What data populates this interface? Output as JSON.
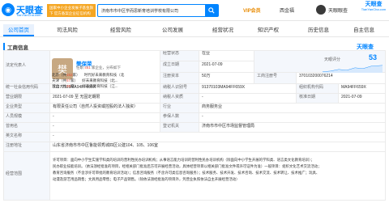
{
  "header": {
    "brand_name": "天眼查",
    "brand_sub": "TianYanCha.com",
    "promo_text": "国家中小企业发展子基金旗下 官方备案企业征信机构",
    "search_value": "济南市市中区学而思新育培训学校有限公司",
    "nav": {
      "vip": "VIP会员",
      "xixin": "西金福",
      "user": "天眼眼查"
    },
    "corner_brand": "天眼查",
    "corner_sub": "TianYanCha.com"
  },
  "tabs": [
    {
      "label": "公司首页",
      "count": ""
    },
    {
      "label": "司法风险",
      "count": ""
    },
    {
      "label": "经营风险",
      "count": ""
    },
    {
      "label": "公司发展",
      "count": ""
    },
    {
      "label": "经营状况",
      "count": ""
    },
    {
      "label": "知识产权",
      "count": ""
    },
    {
      "label": "历史信息",
      "count": ""
    },
    {
      "label": "自主信息",
      "count": ""
    }
  ],
  "section": {
    "title": "工商信息",
    "note": "",
    "brand_right": "天眼查"
  },
  "legal_person": {
    "label": "法定代表人",
    "avatar_char": "樊",
    "name": "樊保荣",
    "meta_prefix": "任职",
    "meta_count": "461",
    "meta_suffix": "家企业，分布如下",
    "rows": [
      {
        "region": "北京",
        "count": "152",
        "company": "时代好未来教育科技（北"
      },
      {
        "region": "天津",
        "count": "57",
        "company": "好未来教育科技（北..."
      },
      {
        "region": "河北",
        "count": "25",
        "company": "好未来教育科技（江..."
      }
    ],
    "tag": "老板"
  },
  "rows": {
    "status_label": "经营状态",
    "status_value": "在业",
    "established_label": "成立日期",
    "established_value": "2021-07-09",
    "reg_capital_label": "注册资本",
    "reg_capital_value": "50万",
    "paid_capital_label": "实缴资本",
    "paid_capital_value": "-",
    "rating_label": "天眼评分",
    "rating_value": "53",
    "reg_no_label": "工商注册号",
    "reg_no_value": "370103200076214",
    "credit_code_label": "统一社会信用代码",
    "credit_code_value": "91370103MA94FF659X",
    "taxpayer_id_label": "纳税人识别号",
    "taxpayer_id_value": "91370103MA94FF659X",
    "org_code_label": "组织机构代码",
    "org_code_value": "MA94FF659X",
    "term_label": "营业期限",
    "term_value": "2021-07-09 至 无固定期限",
    "taxpayer_type_label": "纳税人资质",
    "taxpayer_type_value": "-",
    "approve_label": "核准日期",
    "approve_value": "2021-07-09",
    "company_type_label": "企业类型",
    "company_type_value": "有限责任公司（自然人投资或控股的法人独资）",
    "industry_label": "行业",
    "industry_value": "商务服务业",
    "staff_label": "人员规模",
    "staff_value": "-",
    "insured_label": "参保人数",
    "insured_value": "-",
    "authority_label": "登记机关",
    "authority_value": "济南市市中区市场监督管理局",
    "former_label": "曾用名",
    "former_value": "-",
    "english_label": "英文名称",
    "english_value": "-",
    "address_label": "注册地址",
    "address_value": "山东省济南市市中区鲁能领秀城四区公建104、105、106室",
    "scope_label": "经营范围",
    "scope_lines": [
      "许可项目：面向中小学生实施学科类的培训的营利性民办培训机构；从事语言能力培训的营利性民办培训机构（除面向中小学生开展的学科类、语言类文化教育培训）；",
      "民办职业技能培训。（依法须经批准的项目，经相关部门批准后方可开展经营活动，具体经营项目以相关部门批准文件或许可证件为准）一般项目：组织文化艺术交流活动；",
      "教育咨询服务（不含涉许可审批的教育培训活动）；信息咨询服务（不含许可类信息咨询服务）；技术服务、技术开发、技术咨询、技术交流、技术转让、技术推广；玩具、",
      "动漫及游艺用品销售；文具用品零售；电子产品销售。（除依法须经批准的项目外，凭营业执照依法自主开展经营活动）"
    ]
  }
}
